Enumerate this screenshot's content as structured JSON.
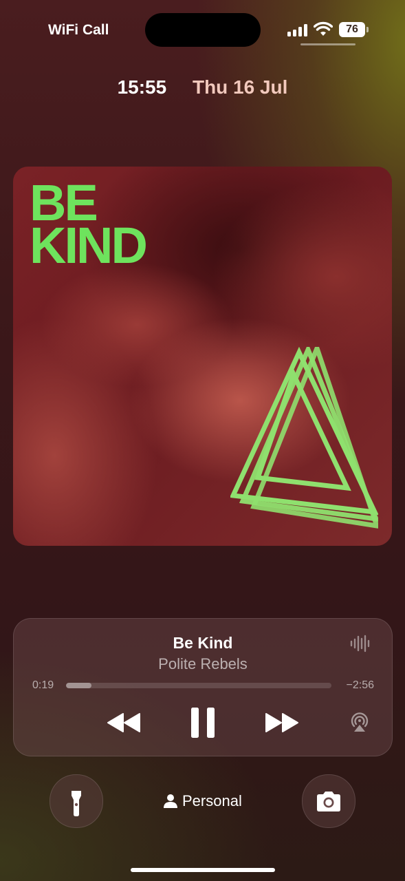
{
  "status_bar": {
    "carrier": "WiFi Call",
    "battery": "76"
  },
  "lock": {
    "time": "15:55",
    "date": "Thu 16 Jul"
  },
  "artwork": {
    "title_line1": "BE",
    "title_line2": "KIND",
    "accent_color": "#6ee35d"
  },
  "now_playing": {
    "title": "Be Kind",
    "artist": "Polite Rebels",
    "elapsed": "0:19",
    "remaining": "−2:56",
    "progress_fraction": 0.097,
    "icons": [
      "waveform-icon",
      "rewind-icon",
      "pause-icon",
      "fast-forward-icon",
      "airplay-icon"
    ]
  },
  "bottom": {
    "focus_label": "Personal",
    "icons": [
      "flashlight-icon",
      "person-icon",
      "camera-icon"
    ]
  }
}
